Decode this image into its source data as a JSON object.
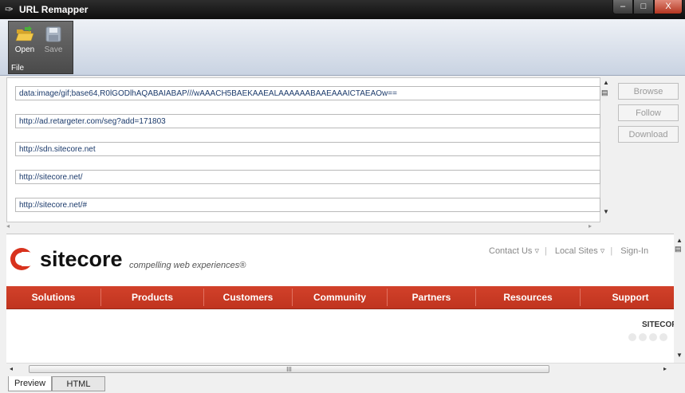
{
  "window": {
    "title": "URL Remapper",
    "controls": {
      "minimize": "–",
      "maximize": "□",
      "close": "X"
    }
  },
  "ribbon": {
    "group_label": "File",
    "open_label": "Open",
    "save_label": "Save"
  },
  "urls": [
    "data:image/gif;base64,R0lGODlhAQABAIABAP///wAAACH5BAEKAAEALAAAAAABAAEAAAICTAEAOw==",
    "http://ad.retargeter.com/seg?add=171803",
    "http://sdn.sitecore.net",
    "http://sitecore.net/",
    "http://sitecore.net/#"
  ],
  "side_buttons": {
    "browse": "Browse",
    "follow": "Follow",
    "download": "Download"
  },
  "page": {
    "logo_text": "sitecore",
    "logo_mark": "®",
    "tagline": "compelling web experiences®",
    "top_links": [
      "Contact Us ▿",
      "Local Sites ▿",
      "Sign-In"
    ],
    "nav": [
      "Solutions",
      "Products",
      "Customers",
      "Community",
      "Partners",
      "Resources",
      "Support"
    ],
    "partial_heading": "SITECOR"
  },
  "scrollbar": {
    "thumb_glyph": "III"
  },
  "tabs": {
    "preview": "Preview",
    "html": "HTML"
  },
  "colors": {
    "accent": "#c8381f",
    "url_text": "#1b3a6b"
  }
}
